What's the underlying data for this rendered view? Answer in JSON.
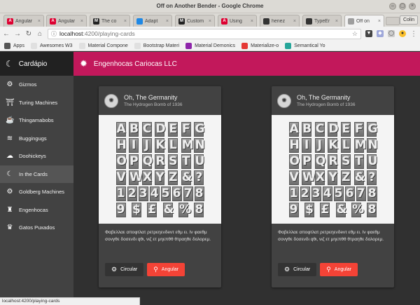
{
  "window": {
    "title": "Off on Another Bender - Google Chrome"
  },
  "tabs": [
    {
      "label": "Angular",
      "fav_color": "#dd0031",
      "fav_glyph": "A"
    },
    {
      "label": "Angular",
      "fav_color": "#dd0031",
      "fav_glyph": "A"
    },
    {
      "label": "The co",
      "fav_color": "#222222",
      "fav_glyph": "M"
    },
    {
      "label": "Adapt",
      "fav_color": "#1e88e5",
      "fav_glyph": ""
    },
    {
      "label": "Custom",
      "fav_color": "#222222",
      "fav_glyph": "M"
    },
    {
      "label": "Using",
      "fav_color": "#dd0031",
      "fav_glyph": "A"
    },
    {
      "label": "henez",
      "fav_color": "#333333",
      "fav_glyph": ""
    },
    {
      "label": "TypeEr",
      "fav_color": "#333333",
      "fav_glyph": ""
    },
    {
      "label": "Off on",
      "fav_color": "#9e9e9e",
      "fav_glyph": ""
    }
  ],
  "profile": "Colin",
  "address": {
    "host": "localhost",
    "path": ":4200/playing-cards"
  },
  "bookmarks": [
    {
      "label": "Apps",
      "color": "#555555"
    },
    {
      "label": "Awesomes W3",
      "color": "#e0e0e0"
    },
    {
      "label": "Material Compone",
      "color": "#e0e0e0"
    },
    {
      "label": "Bootstrap Materi",
      "color": "#e0e0e0"
    },
    {
      "label": "Material Demonics",
      "color": "#8e24aa"
    },
    {
      "label": "Materialize-o",
      "color": "#e53935"
    },
    {
      "label": "Semantical Yo",
      "color": "#26a69a"
    }
  ],
  "sidebar": {
    "brand": "Cardápio",
    "items": [
      {
        "label": "Gizmos",
        "icon": "gear-icon",
        "glyph": "⚙",
        "active": false
      },
      {
        "label": "Turing Machines",
        "icon": "archway-icon",
        "glyph": "⛩",
        "active": false
      },
      {
        "label": "Thingamabobs",
        "icon": "coffee-icon",
        "glyph": "☕",
        "active": false
      },
      {
        "label": "Buggingugs",
        "icon": "waves-icon",
        "glyph": "≋",
        "active": false
      },
      {
        "label": "Doohickeys",
        "icon": "cloud-icon",
        "glyph": "☁",
        "active": false
      },
      {
        "label": "In the Cards",
        "icon": "moon-icon",
        "glyph": "☾",
        "active": true
      },
      {
        "label": "Goldberg Machines",
        "icon": "cog-icon",
        "glyph": "⚙",
        "active": false
      },
      {
        "label": "Engenhocas",
        "icon": "chess-rook-icon",
        "glyph": "♜",
        "active": false
      },
      {
        "label": "Gatos Puxados",
        "icon": "crown-icon",
        "glyph": "♛",
        "active": false
      }
    ]
  },
  "header": {
    "title": "Engenhocas Cariocas LLC"
  },
  "cards": [
    {
      "title": "Oh, The Germanity",
      "subtitle": "The Hydrogen Bomb of 1936",
      "body": "Φαβελλαε αποφτλατ ρετρεηενδeντ εθμ ει. Ιν φαεθμ σονγθε δοσενδι qθι, νιζ ετ μηεπθθ θτραηθε δολορεμ.",
      "btn_circular": "Circular",
      "btn_angular": "Angular"
    },
    {
      "title": "Oh, The Germanity",
      "subtitle": "The Hydrogen Bomb of 1936",
      "body": "Φαβελλαε αποφτλατ ρετρεηενδeντ εθμ ει. Ιν φαεθμ σονγθε δοσενδι qθι, νιζ ετ μηεπθθ θτραηθε δολορεμ.",
      "btn_circular": "Circular",
      "btn_angular": "Angular"
    }
  ],
  "type_rows": [
    "ABCDEFG",
    "HIJKLMN",
    "OPQRSTU",
    "VWXYZ&?",
    "12345678",
    "9$£&%8"
  ],
  "status_url": "localhost:4200/playing-cards",
  "colors": {
    "accent": "#c2185b",
    "sidebar": "#424242",
    "card": "#424242",
    "angular_button": "#f44336"
  }
}
